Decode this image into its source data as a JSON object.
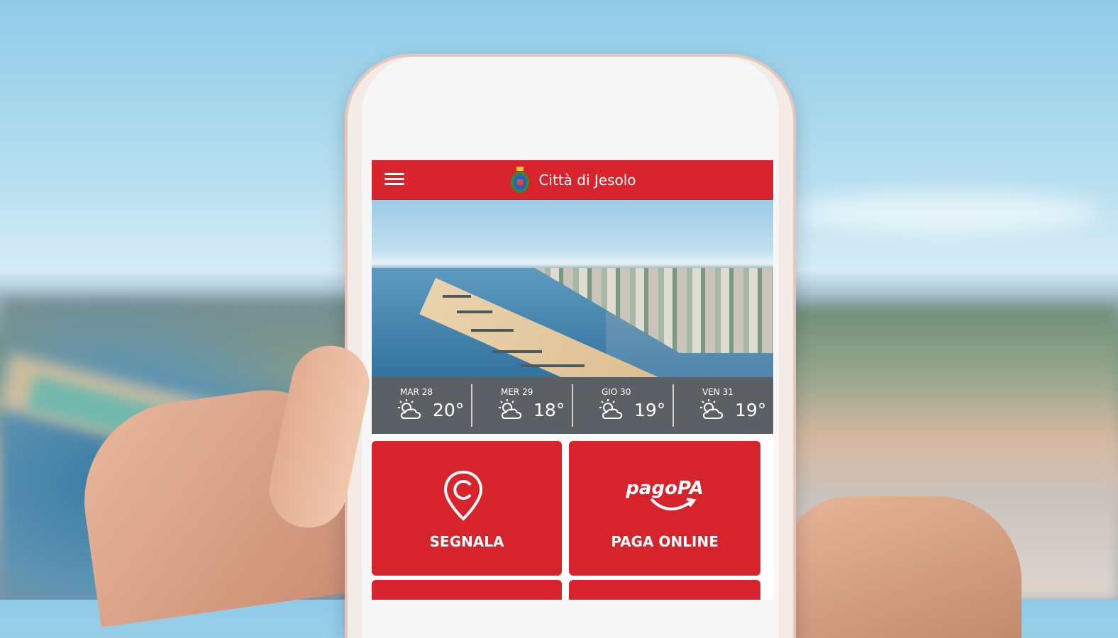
{
  "header": {
    "title": "Città di Jesolo",
    "menu_icon": "hamburger-menu-icon",
    "logo_icon": "city-crest-icon"
  },
  "weather": [
    {
      "day": "MAR 28",
      "temp": "20°",
      "icon": "partly-cloudy-icon"
    },
    {
      "day": "MER 29",
      "temp": "18°",
      "icon": "partly-cloudy-icon"
    },
    {
      "day": "GIO 30",
      "temp": "19°",
      "icon": "partly-cloudy-icon"
    },
    {
      "day": "VEN 31",
      "temp": "19°",
      "icon": "partly-cloudy-icon"
    }
  ],
  "tiles": [
    {
      "label": "SEGNALA",
      "icon": "map-pin-icon"
    },
    {
      "label": "PAGA ONLINE",
      "icon": "pagopa-logo-icon",
      "logo_text": "pagoPA"
    }
  ],
  "colors": {
    "brand_red": "#d7232b",
    "weather_bar": "#5b6065"
  }
}
